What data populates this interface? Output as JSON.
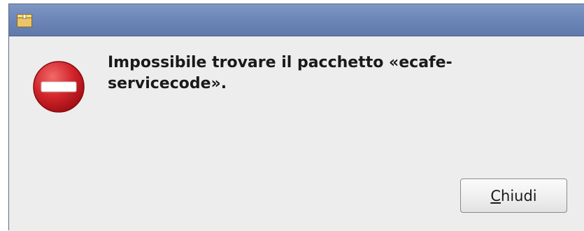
{
  "window": {
    "title": "",
    "icon": "package-icon"
  },
  "dialog": {
    "icon": "error-icon",
    "message": "Impossibile trovare il pacchetto «ecafe-servicecode».",
    "message_line1": "Impossibile trovare il pacchetto «ecafe-",
    "message_line2": "servicecode»."
  },
  "buttons": {
    "close_label": "Chiudi",
    "close_mnemonic": "C",
    "close_rest": "hiudi"
  },
  "colors": {
    "titlebar": "#6d87b8",
    "background": "#ededed",
    "error_red": "#c8161d"
  }
}
